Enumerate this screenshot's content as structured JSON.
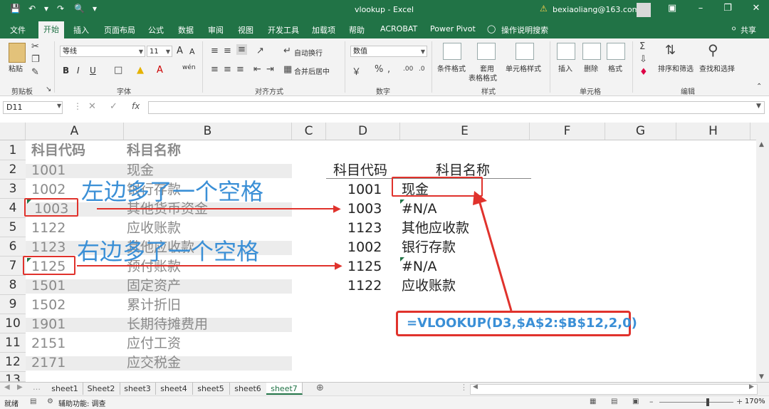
{
  "titlebar": {
    "title": "vlookup  -  Excel",
    "account": "bexiaoliang@163.com",
    "qat_icons": [
      "save-icon",
      "undo-icon",
      "redo-icon",
      "print-preview-icon",
      "customize-icon"
    ]
  },
  "tabs": [
    "文件",
    "开始",
    "插入",
    "页面布局",
    "公式",
    "数据",
    "审阅",
    "视图",
    "开发工具",
    "加载项",
    "帮助",
    "ACROBAT",
    "Power Pivot"
  ],
  "active_tab": "开始",
  "tell_me": "操作说明搜索",
  "share": "共享",
  "ribbon": {
    "clipboard": {
      "paste": "粘贴",
      "group": "剪贴板"
    },
    "font": {
      "name": "等线",
      "size": "11",
      "grow": "A",
      "shrink": "A",
      "bold": "B",
      "italic": "I",
      "underline": "U",
      "wen": "wén",
      "group": "字体"
    },
    "align": {
      "wrap": "自动换行",
      "merge": "合并后居中",
      "group": "对齐方式"
    },
    "number": {
      "format": "数值",
      "group": "数字"
    },
    "styles": {
      "cond": "条件格式",
      "table1": "套用",
      "table2": "表格格式",
      "cell": "单元格样式",
      "group": "样式"
    },
    "cells": {
      "insert": "插入",
      "delete": "删除",
      "format": "格式",
      "group": "单元格"
    },
    "edit": {
      "sort": "排序和筛选",
      "find": "查找和选择",
      "group": "编辑"
    }
  },
  "formula": {
    "namebox": "D11",
    "fx": "fx"
  },
  "columns": [
    "A",
    "B",
    "C",
    "D",
    "E",
    "F",
    "G",
    "H"
  ],
  "rows": [
    "1",
    "2",
    "3",
    "4",
    "5",
    "6",
    "7",
    "8",
    "9",
    "10",
    "11",
    "12",
    "13"
  ],
  "left_table": {
    "header": [
      "科目代码",
      "科目名称"
    ],
    "rows": [
      [
        "1001",
        "现金"
      ],
      [
        "1002",
        "银行存款"
      ],
      [
        "1003",
        "其他货币资金"
      ],
      [
        "1122",
        "应收账款"
      ],
      [
        "1123",
        "其他应收款"
      ],
      [
        "1125",
        "预付账款"
      ],
      [
        "1501",
        "固定资产"
      ],
      [
        "1502",
        "累计折旧"
      ],
      [
        "1901",
        "长期待摊费用"
      ],
      [
        "2151",
        "应付工资"
      ],
      [
        "2171",
        "应交税金"
      ]
    ]
  },
  "right_table": {
    "header": [
      "科目代码",
      "科目名称"
    ],
    "rows": [
      [
        "1001",
        "现金"
      ],
      [
        "1003",
        "#N/A"
      ],
      [
        "1123",
        "其他应收款"
      ],
      [
        "1002",
        "银行存款"
      ],
      [
        "1125",
        "#N/A"
      ],
      [
        "1122",
        "应收账款"
      ]
    ]
  },
  "annotations": {
    "left_space": "左边多了一个空格",
    "right_space": "右边多了一个空格",
    "formula": "=VLOOKUP(D3,$A$2:$B$12,2,0)"
  },
  "sheets": [
    "sheet1",
    "Sheet2",
    "sheet3",
    "sheet4",
    "sheet5",
    "sheet6",
    "sheet7"
  ],
  "active_sheet": "sheet7",
  "status": {
    "ready": "就绪",
    "accessibility": "辅助功能: 调查",
    "zoom": "170%"
  },
  "colors": {
    "excel_green": "#217346",
    "annotation_blue": "#3a8fd6",
    "annotation_red": "#e0322c"
  }
}
